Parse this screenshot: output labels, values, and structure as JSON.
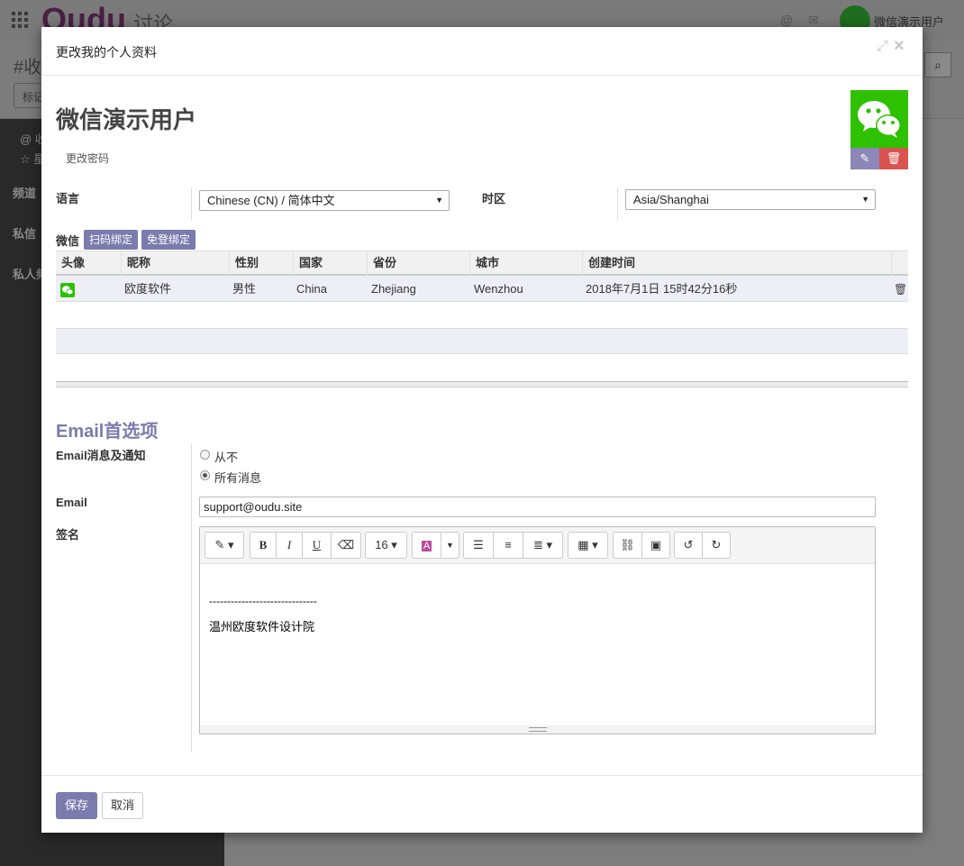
{
  "background": {
    "app_name_logo": "Oudu",
    "app_name_sub": "讨论",
    "user_name": "微信演示用户",
    "page_title": "#收件箱",
    "tag_button": "标记",
    "sidebar_items": [
      "@ 收件箱",
      "☆ 星标",
      "频道",
      "私信",
      "私人频道"
    ]
  },
  "modal": {
    "title": "更改我的个人资料",
    "user_name": "微信演示用户",
    "change_password": "更改密码",
    "language_label": "语言",
    "language_value": "Chinese (CN) / 简体中文",
    "timezone_label": "时区",
    "timezone_value": "Asia/Shanghai",
    "wechat_label": "微信",
    "wechat_bind_qr": "扫码绑定",
    "wechat_bind_free": "免登绑定",
    "table": {
      "headers": [
        "头像",
        "昵称",
        "性别",
        "国家",
        "省份",
        "城市",
        "创建时间"
      ],
      "rows": [
        {
          "nickname": "欧度软件",
          "gender": "男性",
          "country": "China",
          "province": "Zhejiang",
          "city": "Wenzhou",
          "created": "2018年7月1日 15时42分16秒"
        }
      ]
    },
    "email_section_title": "Email首选项",
    "email_notify_label": "Email消息及通知",
    "notify_options": [
      "从不",
      "所有消息"
    ],
    "notify_selected": "所有消息",
    "email_label": "Email",
    "email_value": "support@oudu.site",
    "signature_label": "签名",
    "editor_font_size": "16",
    "signature_line1": "------------------------------",
    "signature_line2": "温州欧度软件设计院",
    "save_label": "保存",
    "cancel_label": "取消"
  },
  "colors": {
    "accent": "#7c7bad",
    "wechat_green": "#2dc100",
    "danger": "#d9534f"
  }
}
